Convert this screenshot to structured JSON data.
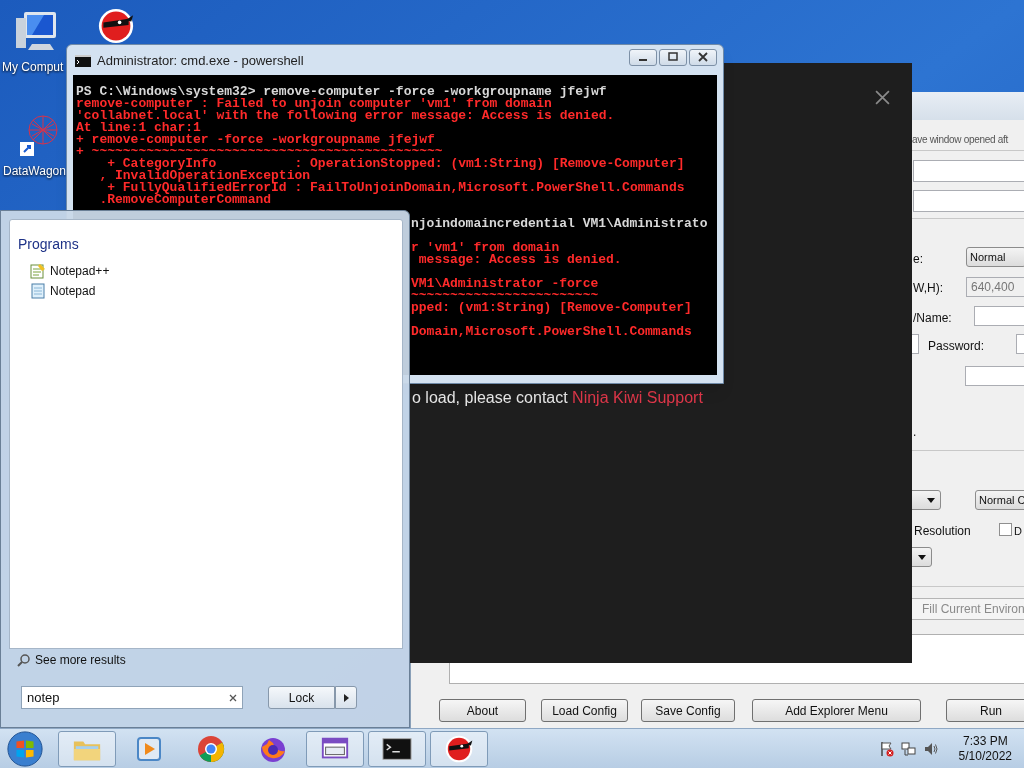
{
  "desktop_icons": [
    {
      "label": "My Comput",
      "kind": "computer"
    },
    {
      "kind": "ninja"
    },
    {
      "label": "DataWagon",
      "kind": "datawagon"
    }
  ],
  "config_window": {
    "items": [
      {
        "kind": "label",
        "text": "ave window opened aft"
      },
      {
        "kind": "field",
        "value": ""
      },
      {
        "kind": "field",
        "value": ""
      },
      {
        "kind": "label",
        "text": "e:"
      },
      {
        "kind": "dropdown",
        "value": "Normal"
      },
      {
        "kind": "label",
        "text": "W,H):"
      },
      {
        "kind": "field",
        "value": "640,400",
        "disabled": true
      },
      {
        "kind": "label",
        "text": "/Name:"
      },
      {
        "kind": "field",
        "value": ""
      },
      {
        "kind": "field",
        "value": ""
      },
      {
        "kind": "label",
        "text": "Password:"
      },
      {
        "kind": "field",
        "value": ""
      },
      {
        "kind": "field",
        "value": ""
      },
      {
        "kind": "label",
        "text": "."
      },
      {
        "kind": "dropdown",
        "value": ""
      },
      {
        "kind": "dropdown",
        "value": "Normal C"
      },
      {
        "kind": "label",
        "text": "Resolution"
      },
      {
        "kind": "checkbox",
        "text": "D",
        "checked": false
      },
      {
        "kind": "dropdown",
        "value": ""
      },
      {
        "kind": "button",
        "text": "Fill Current Environ",
        "disabled": true
      }
    ],
    "buttons": [
      "About",
      "Load Config",
      "Save Config",
      "Add Explorer Menu",
      "Run"
    ]
  },
  "game_overlay": {
    "message": "o load, please contact",
    "link": "Ninja Kiwi Support"
  },
  "cmd_window": {
    "title": "Administrator: cmd.exe - powershell",
    "lines": [
      {
        "text": "PS C:\\Windows\\system32> remove-computer -force -workgroupname jfejwf",
        "color": "#d8d8d8"
      },
      {
        "text": "remove-computer : Failed to unjoin computer 'vm1' from domain",
        "color": "#ff2a2a"
      },
      {
        "text": "'collabnet.local' with the following error message: Access is denied.",
        "color": "#ff2a2a"
      },
      {
        "text": "At line:1 char:1",
        "color": "#ff2a2a"
      },
      {
        "text": "+ remove-computer -force -workgroupname jfejwf",
        "color": "#ff2a2a"
      },
      {
        "text": "+ ~~~~~~~~~~~~~~~~~~~~~~~~~~~~~~~~~~~~~~~~~~~~~",
        "color": "#ff2a2a"
      },
      {
        "text": "    + CategoryInfo          : OperationStopped: (vm1:String) [Remove-Computer]",
        "color": "#ff2a2a"
      },
      {
        "text": "   , InvalidOperationException",
        "color": "#ff2a2a"
      },
      {
        "text": "    + FullyQualifiedErrorId : FailToUnjoinDomain,Microsoft.PowerShell.Commands",
        "color": "#ff2a2a"
      },
      {
        "text": "   .RemoveComputerCommand",
        "color": "#ff2a2a"
      }
    ],
    "covered_lines": [
      {
        "text": "njoindomaincredential VM1\\Administrato",
        "color": "#d8d8d8"
      },
      {
        "text": "r 'vm1' from domain",
        "color": "#ff2a2a"
      },
      {
        "text": " message: Access is denied.",
        "color": "#ff2a2a"
      },
      {
        "text": "VM1\\Administrator -force",
        "color": "#ff2a2a"
      },
      {
        "text": "~~~~~~~~~~~~~~~~~~~~~~~~",
        "color": "#ff2a2a"
      },
      {
        "text": "pped: (vm1:String) [Remove-Computer]",
        "color": "#ff2a2a"
      },
      {
        "text": "Domain,Microsoft.PowerShell.Commands",
        "color": "#ff2a2a"
      }
    ]
  },
  "start_menu": {
    "section": "Programs",
    "programs": [
      {
        "name": "Notepad++",
        "kind": "notepadpp"
      },
      {
        "name": "Notepad",
        "kind": "notepad"
      }
    ],
    "see_more": "See more results",
    "search": {
      "value": "notep"
    },
    "power_button": "Lock"
  },
  "taskbar": {
    "items": [
      {
        "kind": "explorer",
        "open": true
      },
      {
        "kind": "media",
        "open": false
      },
      {
        "kind": "chrome",
        "open": false
      },
      {
        "kind": "firefox",
        "open": false
      },
      {
        "kind": "app",
        "open": true
      },
      {
        "kind": "cmd",
        "open": true
      },
      {
        "kind": "ninja",
        "open": true
      }
    ],
    "clock": {
      "time": "7:33 PM",
      "date": "5/10/2022"
    }
  }
}
